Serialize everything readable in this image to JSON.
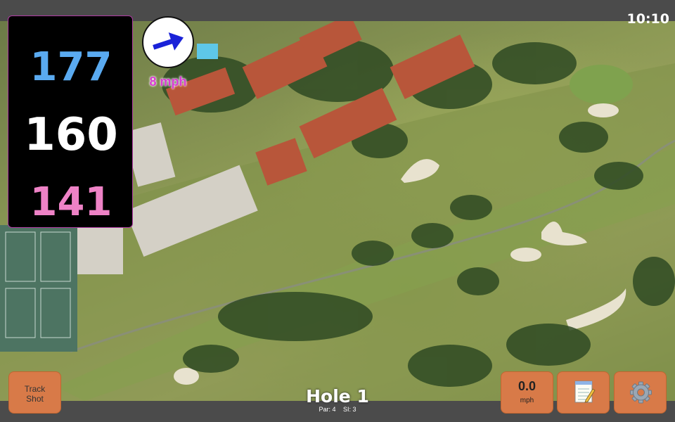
{
  "status_bar": {
    "clock": "10:10"
  },
  "yardages": {
    "back": "177",
    "center": "160",
    "front": "141"
  },
  "wind": {
    "speed_label": "8 mph",
    "direction_icon": "arrow-east-icon"
  },
  "hole": {
    "title": "Hole 1",
    "par": "Par: 4",
    "si": "SI: 3"
  },
  "buttons": {
    "track_shot_line1": "Track",
    "track_shot_line2": "Shot",
    "wind_value": "0.0",
    "wind_unit": "mph",
    "notes_icon": "notepad-icon",
    "settings_icon": "gear-icon"
  },
  "colors": {
    "back_yardage": "#5aaaf0",
    "center_yardage": "#ffffff",
    "front_yardage": "#ee82c6",
    "button_bg": "#d87a48",
    "wind_label": "#d93bd2"
  }
}
